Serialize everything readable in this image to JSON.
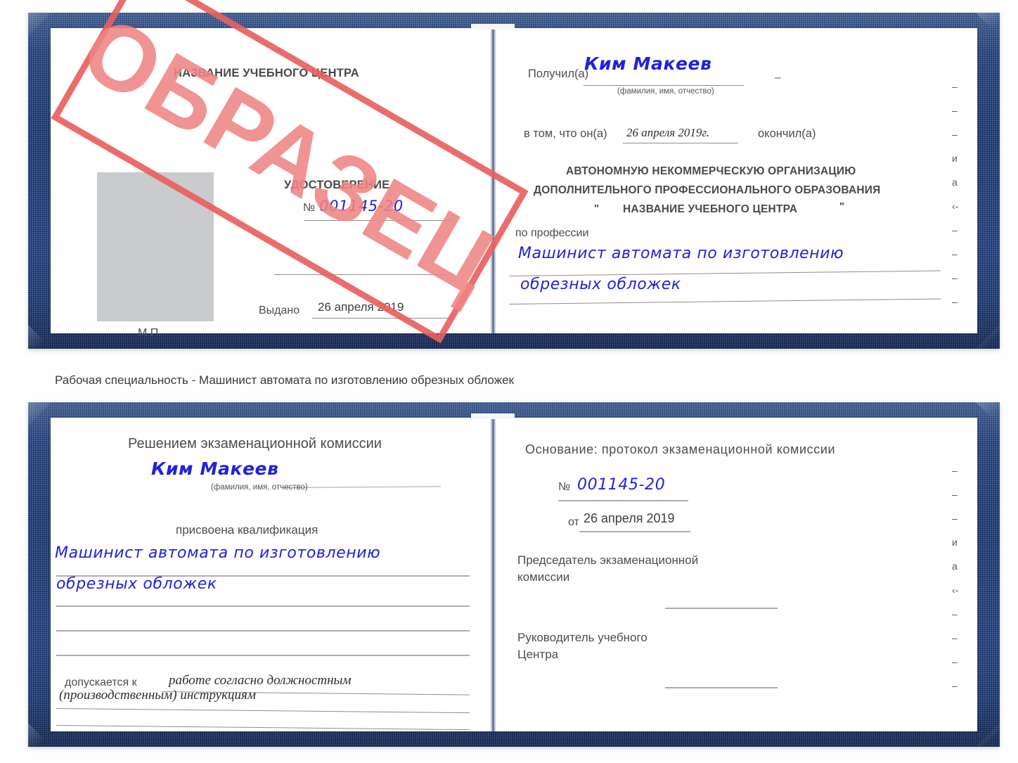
{
  "document": {
    "kind": "Удостоверение (сертификат)",
    "watermark": "ОБРАЗЕЦ",
    "caption": "Рабочая специальность - Машинист автомата по изготовлению обрезных обложек"
  },
  "colors": {
    "cover_blue": "#1e3f7e",
    "stamp_red": "#e8615f",
    "stamp_text_red": "#ef8585",
    "ink_blue": "#2222d8",
    "photo_placeholder": "#c9cbcc",
    "paper_white": "#ffffff"
  },
  "top_spread": {
    "left_page": {
      "center_name": "НАЗВАНИЕ УЧЕБНОГО ЦЕНТРА",
      "doc_title": "УДОСТОВЕРЕНИЕ",
      "number_label": "№",
      "number_value": "001145-20",
      "issued_label": "Выдано",
      "issued_value": "26 апреля 2019",
      "seal_label": "М.П."
    },
    "right_page": {
      "received_label": "Получил(а)",
      "received_value": "Ким Макеев",
      "received_hint": "(фамилия, имя, отчество)",
      "in_that_label": "в том, что он(а)",
      "completion_date": "26 апреля 2019г.",
      "graduated_label": "окончил(а)",
      "org_line1": "АВТОНОМНУЮ НЕКОММЕРЧЕСКУЮ ОРГАНИЗАЦИЮ",
      "org_line2": "ДОПОЛНИТЕЛЬНОГО ПРОФЕССИОНАЛЬНОГО ОБРАЗОВАНИЯ",
      "org_quote_open": "\"",
      "org_line3": "НАЗВАНИЕ УЧЕБНОГО ЦЕНТРА",
      "org_quote_close": "\"",
      "profession_label": "по профессии",
      "profession_line1": "Машинист автомата по изготовлению",
      "profession_line2": "обрезных обложек",
      "margin_glyphs": [
        "–",
        "–",
        "–",
        "и",
        "а",
        "‹-",
        "–",
        "–",
        "–",
        "–"
      ]
    }
  },
  "bottom_spread": {
    "left_page": {
      "decision_title": "Решением экзаменационной комиссии",
      "name_value": "Ким Макеев",
      "name_hint": "(фамилия, имя, отчество)",
      "qualification_label": "присвоена квалификация",
      "qualification_line1": "Машинист автомата по изготовлению",
      "qualification_line2": "обрезных обложек",
      "admitted_label": "допускается к",
      "admitted_line1": "работе согласно должностным",
      "admitted_line2": "(производственным) инструкциям"
    },
    "right_page": {
      "basis_label": "Основание: протокол экзаменационной комиссии",
      "number_label": "№",
      "number_value": "001145-20",
      "from_label": "от",
      "from_value": "26 апреля 2019",
      "chairman_line1": "Председатель экзаменационной",
      "chairman_line2": "комиссии",
      "head_line1": "Руководитель учебного",
      "head_line2": "Центра",
      "margin_glyphs": [
        "–",
        "–",
        "–",
        "и",
        "а",
        "‹-",
        "–",
        "–",
        "–",
        "–"
      ]
    }
  }
}
